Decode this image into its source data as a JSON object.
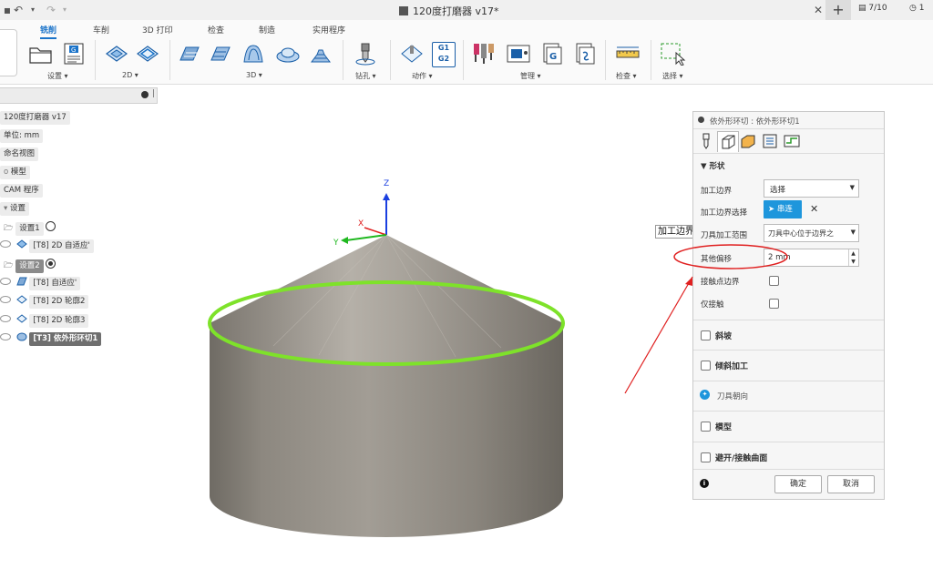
{
  "window": {
    "title": "120度打磨器 v17*",
    "job_count": "7/10",
    "clock_badge": "1"
  },
  "ribbon": {
    "tabs": [
      "铣削",
      "车削",
      "3D 打印",
      "检查",
      "制造",
      "实用程序"
    ],
    "groups": [
      "设置",
      "2D",
      "3D",
      "钻孔",
      "动作",
      "管理",
      "检查",
      "选择"
    ],
    "nc_icon": "G1\nG2"
  },
  "browser": {
    "items": [
      "120度打磨器 v17",
      "单位: mm",
      "命名视图",
      "模型",
      "CAM 程序",
      "设置",
      "设置1",
      "[T8] 2D 自适应'",
      "设置2",
      "[T8] 自适应'",
      "[T8] 2D 轮廓2",
      "[T8] 2D 轮廓3",
      "[T3] 依外形环切1"
    ]
  },
  "viewport": {
    "axis_x": "X",
    "axis_y": "Y",
    "axis_z": "Z",
    "tooltip": "加工边界选择"
  },
  "dialog": {
    "title": "依外形环切 : 依外形环切1",
    "section_shape": "形状",
    "machining_boundary_label": "加工边界",
    "machining_boundary_value": "选择",
    "boundary_selection_label": "加工边界选择",
    "boundary_selection_button": "串连",
    "tool_containment_label": "刀具加工范围",
    "tool_containment_value": "刀具中心位于边界之",
    "additional_offset_label": "其他偏移",
    "additional_offset_value": "2 mm",
    "touch_boundary_label": "接触点边界",
    "touch_only_label": "仅接触",
    "section_ramp": "斜坡",
    "section_tilt": "倾斜加工",
    "tool_orientation": "刀具朝向",
    "section_model": "模型",
    "section_avoid": "避开/接触曲面",
    "ok": "确定",
    "cancel": "取消"
  },
  "colors": {
    "accent": "#1a73c9",
    "selection_green": "#7ee22a",
    "annotation_red": "#e02020",
    "model_gray": "#8c877f"
  }
}
